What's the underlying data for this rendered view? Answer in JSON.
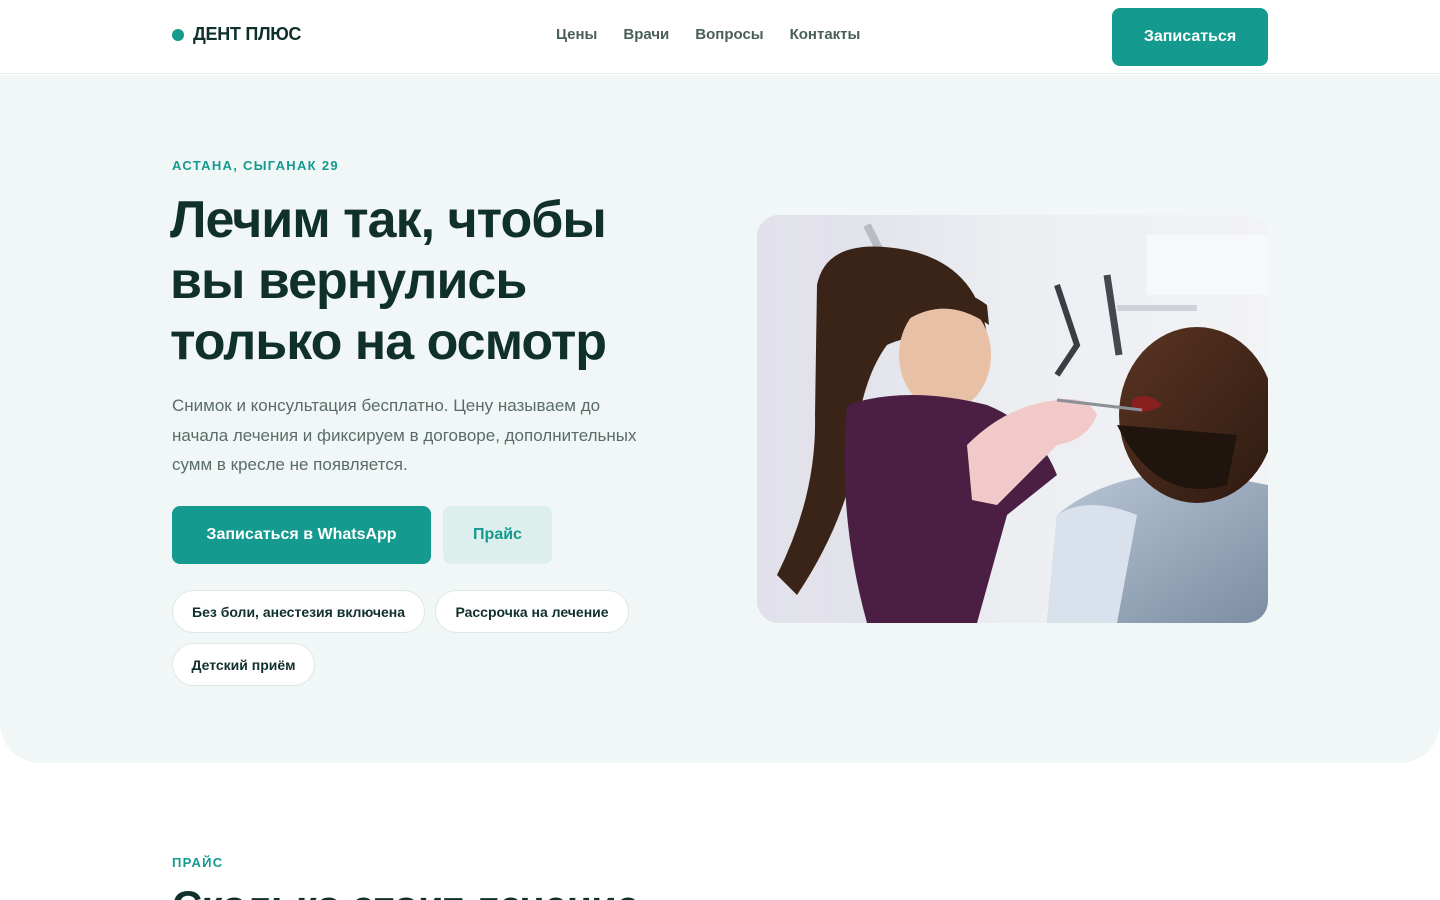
{
  "brand": {
    "name": "ДЕНТ ПЛЮС",
    "accent": "#149a8f"
  },
  "nav": {
    "items": [
      {
        "label": "Цены"
      },
      {
        "label": "Врачи"
      },
      {
        "label": "Вопросы"
      },
      {
        "label": "Контакты"
      }
    ],
    "cta": "Записаться"
  },
  "hero": {
    "eyebrow": "АСТАНА, СЫГАНАК 29",
    "title": "Лечим так, чтобы вы вернулись только на осмотр",
    "lead": "Снимок и консультация бесплатно. Цену называем до начала лечения и фиксируем в договоре, дополнительных сумм в кресле не появляется.",
    "primary_button": "Записаться в WhatsApp",
    "secondary_button": "Прайс",
    "chips": [
      {
        "label": "Без боли, анестезия включена"
      },
      {
        "label": "Рассрочка на лечение"
      },
      {
        "label": "Детский приём"
      }
    ],
    "image_icon": "dentist-photo"
  },
  "pricing": {
    "label": "ПРАЙС",
    "title": "Сколько стоит лечение"
  }
}
